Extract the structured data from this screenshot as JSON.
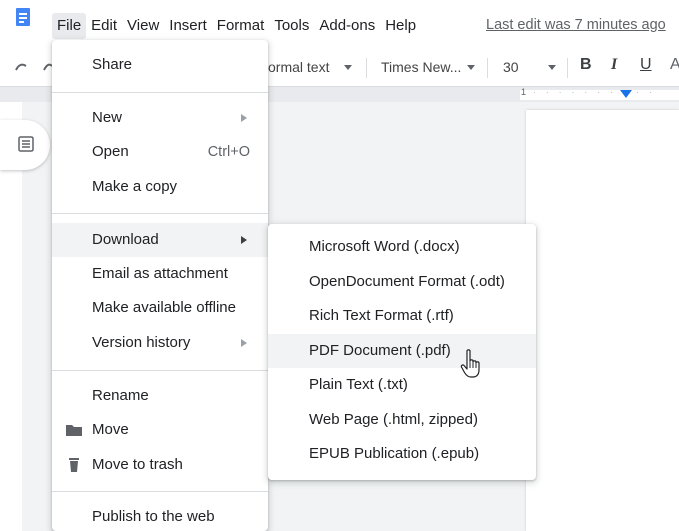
{
  "menubar": {
    "items": [
      "File",
      "Edit",
      "View",
      "Insert",
      "Format",
      "Tools",
      "Add-ons",
      "Help"
    ],
    "last_edit": "Last edit was 7 minutes ago"
  },
  "toolbar": {
    "style": "ormal text",
    "font": "Times New...",
    "size": "30",
    "bold": "B",
    "italic": "I",
    "underline": "U",
    "ruler_number": "1"
  },
  "file_menu": {
    "share": "Share",
    "new": "New",
    "open": "Open",
    "open_shortcut": "Ctrl+O",
    "make_copy": "Make a copy",
    "download": "Download",
    "email": "Email as attachment",
    "offline": "Make available offline",
    "version_history": "Version history",
    "rename": "Rename",
    "move": "Move",
    "trash": "Move to trash",
    "publish": "Publish to the web"
  },
  "download_menu": {
    "items": [
      "Microsoft Word (.docx)",
      "OpenDocument Format (.odt)",
      "Rich Text Format (.rtf)",
      "PDF Document (.pdf)",
      "Plain Text (.txt)",
      "Web Page (.html, zipped)",
      "EPUB Publication (.epub)"
    ]
  },
  "icons": {
    "docs_logo": "google-docs-icon",
    "outline": "outline-icon",
    "folder": "folder-icon",
    "trash": "trash-icon",
    "cursor": "hand-pointer-icon"
  },
  "colors": {
    "accent": "#1a73e8",
    "docs_blue": "#4285f4",
    "hover": "#f1f3f4"
  }
}
